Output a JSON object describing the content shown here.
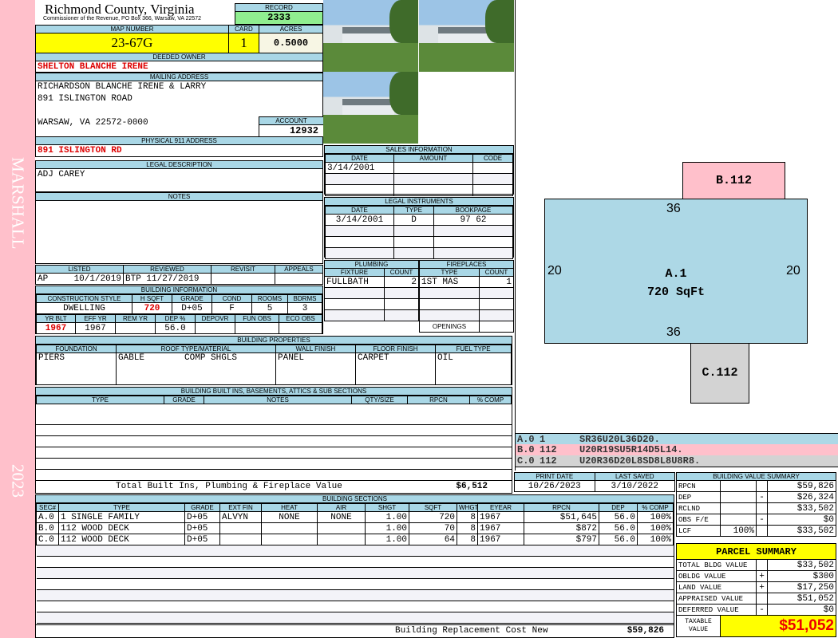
{
  "side": {
    "district": "MARSHALL",
    "year": "2023"
  },
  "header": {
    "county": "Richmond County, Virginia",
    "office": "Commissioner of the Revenue, PO Box 366, Warsaw, VA 22572",
    "record_label": "RECORD",
    "record": "2333"
  },
  "parcel": {
    "map_label": "MAP NUMBER",
    "map": "23-67G",
    "card_label": "CARD",
    "card": "1",
    "acres_label": "ACRES",
    "acres": "0.5000"
  },
  "owner": {
    "label": "DEEDED OWNER",
    "name": "SHELTON BLANCHE IRENE"
  },
  "mailing": {
    "label": "MAILING ADDRESS",
    "line1": "RICHARDSON BLANCHE IRENE & LARRY",
    "line2": "891 ISLINGTON ROAD",
    "line3": "WARSAW, VA 22572-0000",
    "account_label": "ACCOUNT",
    "account": "12932"
  },
  "physical": {
    "label": "PHYSICAL 911 ADDRESS",
    "address": "891 ISLINGTON RD"
  },
  "legal": {
    "label": "LEGAL DESCRIPTION",
    "text": "ADJ CAREY"
  },
  "notes": {
    "label": "NOTES"
  },
  "sales": {
    "label": "SALES INFORMATION",
    "cols": [
      "DATE",
      "AMOUNT",
      "CODE"
    ],
    "rows": [
      [
        "3/14/2001",
        "",
        ""
      ]
    ]
  },
  "instruments": {
    "label": "LEGAL INSTRUMENTS",
    "cols": [
      "DATE",
      "TYPE",
      "BOOKPAGE"
    ],
    "rows": [
      [
        "3/14/2001",
        "D",
        "97 62"
      ]
    ]
  },
  "listing": {
    "cols": [
      "LISTED",
      "REVIEWED",
      "REVISIT",
      "APPEALS"
    ],
    "listed_by": "AP",
    "listed": "10/1/2019",
    "reviewed_by": "BTP",
    "reviewed": "11/27/2019"
  },
  "building_info": {
    "label": "BUILDING INFORMATION",
    "cols1": [
      "CONSTRUCTION STYLE",
      "H SQFT",
      "GRADE",
      "COND",
      "ROOMS",
      "BDRMS"
    ],
    "vals1": [
      "DWELLING",
      "720",
      "D+05",
      "F",
      "5",
      "3"
    ],
    "cols2": [
      "YR BLT",
      "EFF YR",
      "REM YR",
      "DEP %",
      "DEPOVR",
      "FUN OBS",
      "ECO OBS"
    ],
    "vals2": [
      "1967",
      "1967",
      "",
      "56.0",
      "",
      "",
      ""
    ]
  },
  "plumbing": {
    "label": "PLUMBING",
    "cols": [
      "FIXTURE",
      "COUNT"
    ],
    "rows": [
      [
        "FULLBATH",
        "2"
      ]
    ]
  },
  "fireplaces": {
    "label": "FIREPLACES",
    "cols": [
      "TYPE",
      "COUNT"
    ],
    "rows": [
      [
        "1ST MAS",
        "1"
      ]
    ],
    "openings_label": "OPENINGS"
  },
  "properties": {
    "label": "BUILDING PROPERTIES",
    "cols": [
      "FOUNDATION",
      "ROOF TYPE/MATERIAL",
      "WALL FINISH",
      "FLOOR FINISH",
      "FUEL TYPE"
    ],
    "foundation": "PIERS",
    "roof_type": "GABLE",
    "roof_material": "COMP SHGLS",
    "wall": "PANEL",
    "floor": "CARPET",
    "fuel": "OIL"
  },
  "builtins": {
    "label": "BUILDING BUILT INS, BASEMENTS, ATTICS & SUB SECTIONS",
    "cols": [
      "TYPE",
      "GRADE",
      "NOTES",
      "QTY/SIZE",
      "RPCN",
      "% COMP"
    ],
    "total_label": "Total Built Ins, Plumbing & Fireplace Value",
    "total": "$6,512"
  },
  "dates": {
    "print_label": "PRINT DATE",
    "print": "10/26/2023",
    "saved_label": "LAST SAVED",
    "saved": "3/10/2022"
  },
  "sections": {
    "label": "BUILDING SECTIONS",
    "cols": [
      "SEC#",
      "TYPE",
      "GRADE",
      "EXT FIN",
      "HEAT",
      "AIR",
      "SHGT",
      "SQFT",
      "WHGT",
      "EYEAR",
      "RPCN",
      "DEP",
      "% COMP"
    ],
    "rows": [
      [
        "A.0",
        "1 SINGLE FAMILY",
        "D+05",
        "ALVYN",
        "NONE",
        "NONE",
        "1.00",
        "720",
        "8",
        "1967",
        "$51,645",
        "56.0",
        "100%"
      ],
      [
        "B.0",
        "112 WOOD DECK",
        "D+05",
        "",
        "",
        "",
        "1.00",
        "70",
        "8",
        "1967",
        "$872",
        "56.0",
        "100%"
      ],
      [
        "C.0",
        "112 WOOD DECK",
        "D+05",
        "",
        "",
        "",
        "1.00",
        "64",
        "8",
        "1967",
        "$797",
        "56.0",
        "100%"
      ]
    ],
    "total_label": "Building Replacement Cost New",
    "total": "$59,826"
  },
  "sketch": {
    "areas": [
      {
        "label": "B.112",
        "color": "#ffc0cb"
      },
      {
        "label": "A.1",
        "sqft": "720 SqFt",
        "color": "#add8e6"
      },
      {
        "label": "C.112",
        "color": "#d3d3d3"
      }
    ],
    "dims": {
      "top": "36",
      "bottom": "36",
      "left": "20",
      "right": "20"
    },
    "codes": [
      [
        "A.0",
        "1",
        "SR36U20L36D20."
      ],
      [
        "B.0",
        "112",
        "U20R19SU5R14D5L14."
      ],
      [
        "C.0",
        "112",
        "U20R36D20L8SD8L8U8R8."
      ]
    ]
  },
  "value_summary": {
    "label": "BUILDING VALUE SUMMARY",
    "rows": [
      [
        "RPCN",
        "",
        "",
        "$59,826"
      ],
      [
        "DEP",
        "",
        "-",
        "$26,324"
      ],
      [
        "RCLND",
        "",
        "",
        "$33,502"
      ],
      [
        "OBS F/E",
        "",
        "-",
        "$0"
      ],
      [
        "LCF",
        "100%",
        "",
        "$33,502"
      ]
    ]
  },
  "parcel_summary": {
    "label": "PARCEL SUMMARY",
    "rows": [
      [
        "TOTAL BLDG VALUE",
        "",
        "$33,502"
      ],
      [
        "OBLDG VALUE",
        "+",
        "$300"
      ],
      [
        "LAND VALUE",
        "+",
        "$17,250"
      ],
      [
        "APPRAISED VALUE",
        "",
        "$51,052"
      ],
      [
        "DEFERRED VALUE",
        "-",
        "$0"
      ]
    ],
    "taxable_label": "TAXABLE VALUE",
    "taxable": "$51,052"
  }
}
